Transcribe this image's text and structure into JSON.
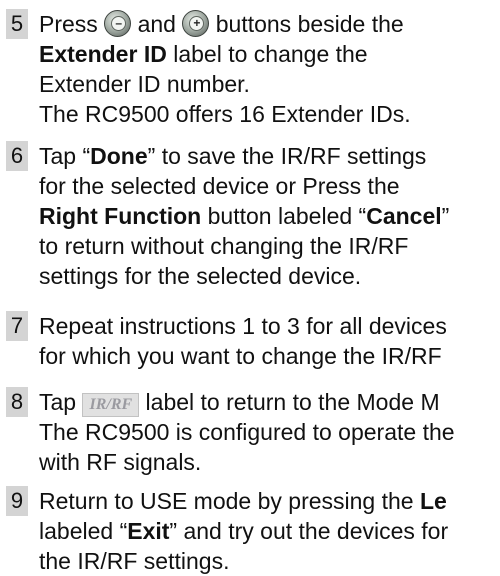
{
  "steps": [
    {
      "number": "5",
      "lines": {
        "l1": {
          "a": "Press ",
          "b": " and ",
          "c": " buttons beside the"
        },
        "l2": {
          "bold": "Extender ID",
          "rest": " label to change the"
        },
        "l3": "Extender ID number.",
        "l4": "The RC9500 offers 16 Extender IDs."
      },
      "icons": {
        "minus": "minus-circle-icon",
        "plus": "plus-circle-icon"
      }
    },
    {
      "number": "6",
      "lines": {
        "l1": {
          "a": "Tap “",
          "bold": "Done",
          "b": "” to save the IR/RF settings"
        },
        "l2": "for the selected device or Press the",
        "l3": {
          "bold": "Right Function",
          "a": " button labeled “",
          "bold2": "Cancel",
          "b": "”"
        },
        "l4": "to return without changing the IR/RF",
        "l5": "settings for the selected device."
      }
    },
    {
      "number": "7",
      "lines": {
        "l1": "Repeat instructions 1 to 3 for all devices",
        "l2": "for which you want to change the IR/RF"
      }
    },
    {
      "number": "8",
      "lines": {
        "l1": {
          "a": "Tap ",
          "badge": "IR/RF",
          "b": " label to return to the Mode M"
        },
        "l2": "The RC9500 is configured to operate the",
        "l3": "with RF signals."
      }
    },
    {
      "number": "9",
      "lines": {
        "l1": {
          "a": "Return to USE mode by pressing the ",
          "bold": "Le"
        },
        "l2": {
          "a": "labeled “",
          "bold": "Exit",
          "b": "” and try out the devices for"
        },
        "l3": "the IR/RF settings."
      }
    }
  ]
}
